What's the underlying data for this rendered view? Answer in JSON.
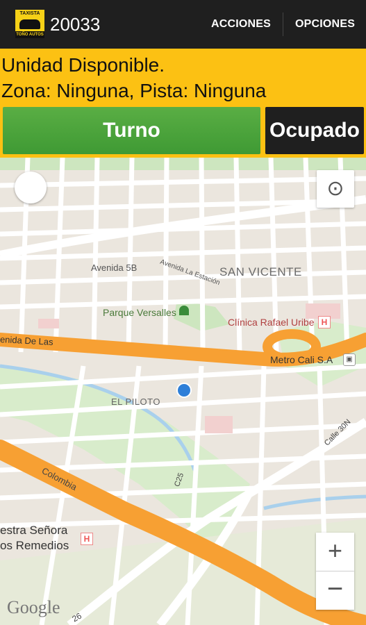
{
  "appbar": {
    "logo_top": "TAXISTA",
    "logo_bottom": "TOÑO AUTOS",
    "title": "20033",
    "menu_acciones": "ACCIONES",
    "menu_opciones": "OPCIONES"
  },
  "status": {
    "line1": "Unidad Disponible.",
    "line2": "Zona: Ninguna, Pista: Ninguna"
  },
  "buttons": {
    "turno": "Turno",
    "ocupado": "Ocupado"
  },
  "map": {
    "labels": {
      "avenida5b": "Avenida 5B",
      "avenida_estacion": "Avenida La Estación",
      "san_vicente": "SAN VICENTE",
      "parque_versalles": "Parque Versalles",
      "clinica": "Clínica Rafael Uribe",
      "avenida_de_las": "enida De Las",
      "metro_cali": "Metro Cali S.A",
      "el_piloto": "EL PILOTO",
      "calle_30n": "Calle 30N",
      "colombia": "Colombia",
      "c25": "C25",
      "senora_line1": "estra Señora",
      "senora_line2": "os Remedios",
      "road_26": "26"
    },
    "zoom_in": "+",
    "zoom_out": "−",
    "attribution": "Google",
    "icons": {
      "compass": "compass-icon",
      "locate": "my-location-icon",
      "park": "tree-icon",
      "hospital": "hospital-icon",
      "bus": "bus-icon"
    },
    "colors": {
      "highway": "#f7a033",
      "park": "#cde6bf",
      "water": "#a9d0ec",
      "location": "#2e7fd8"
    }
  }
}
